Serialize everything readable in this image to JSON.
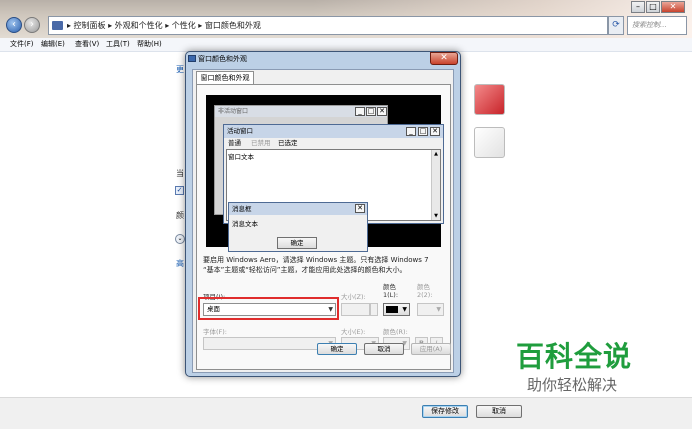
{
  "explorer": {
    "breadcrumb": "▸ 控制面板 ▸ 外观和个性化 ▸ 个性化 ▸ 窗口颜色和外观",
    "search_placeholder": "搜索控制...",
    "window_buttons": {
      "minimize": "–",
      "maximize": "□",
      "close": "✕"
    },
    "menu": [
      "文件(F)",
      "编辑(E)",
      "查看(V)",
      "工具(T)",
      "帮助(H)"
    ],
    "side_links": [
      "更",
      "当",
      "颜",
      "高"
    ],
    "footer_buttons": {
      "save": "保存修改",
      "cancel": "取消"
    }
  },
  "dialog": {
    "title": "窗口颜色和外观",
    "close_glyph": "✕",
    "tab": "窗口颜色和外观",
    "preview": {
      "inactive_title": "非活动窗口",
      "active_title": "活动窗口",
      "menu_items": [
        "普通",
        "已禁用",
        "已选定"
      ],
      "window_text": "窗口文本",
      "msg_title": "消息框",
      "msg_text": "消息文本",
      "msg_ok": "确定",
      "caption_glyphs": [
        "_",
        "□",
        "✕"
      ]
    },
    "description": "要启用 Windows Aero，请选择 Windows 主题。只有选择 Windows 7 “基本”主题或“轻松访问”主题，才能应用此处选择的颜色和大小。",
    "fields": {
      "item_label": "项目(I):",
      "item_value": "桌面",
      "size_z_label": "大小(Z):",
      "color1_label_top": "颜色",
      "color1_label": "1(L):",
      "color2_label_top": "颜色",
      "color2_label": "2(2):",
      "font_label": "字体(F):",
      "size_e_label": "大小(E):",
      "color_r_label": "颜色(R):",
      "bold": "B",
      "italic": "I"
    },
    "buttons": {
      "ok": "确定",
      "cancel": "取消",
      "apply": "应用(A)"
    }
  },
  "watermark": {
    "main": "百科全说",
    "sub": "助你轻松解决"
  },
  "colors": {
    "accent_swatch": "#d93a3a",
    "selected_swatch": "#f4f4f4",
    "highlight_border": "#e02d2d",
    "watermark_green": "#1f9d3d"
  }
}
